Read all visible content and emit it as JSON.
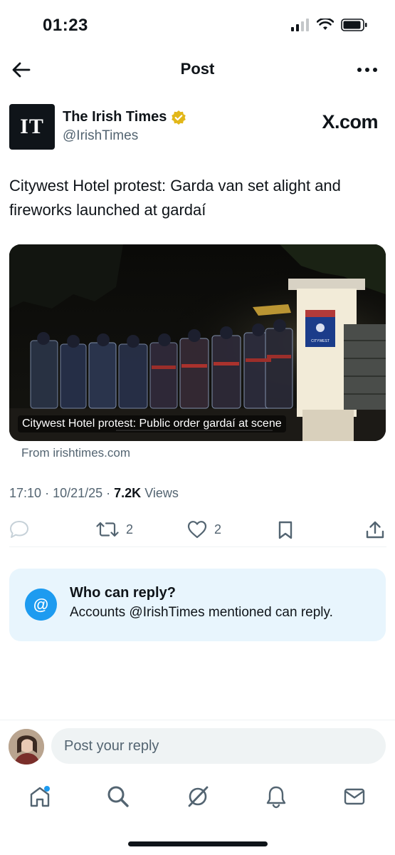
{
  "status": {
    "time": "01:23"
  },
  "header": {
    "title": "Post"
  },
  "author": {
    "avatar_text": "IT",
    "name": "The Irish Times",
    "handle": "@IrishTimes",
    "source_brand": "X.com",
    "verified": true
  },
  "tweet": {
    "text": "Citywest Hotel protest: Garda van set alight and fireworks launched at gardaí"
  },
  "media": {
    "caption": "Citywest Hotel protest: Public order gardaí at scene",
    "sign_text": "CITYWEST",
    "from": "From irishtimes.com"
  },
  "meta": {
    "time": "17:10",
    "date": "10/21/25",
    "views_count": "7.2K",
    "views_label": "Views"
  },
  "actions": {
    "reposts": "2",
    "likes": "2"
  },
  "who_can_reply": {
    "icon": "@",
    "title": "Who can reply?",
    "subtitle": "Accounts @IrishTimes mentioned can reply."
  },
  "composer": {
    "placeholder": "Post your reply"
  },
  "colors": {
    "accent": "#1d9bf0",
    "muted": "#536471",
    "verified": "#e2b719",
    "reply_bg": "#e8f5fd"
  },
  "icons": [
    "back-arrow-icon",
    "more-icon",
    "verified-badge-icon",
    "reply-icon",
    "repost-icon",
    "like-icon",
    "bookmark-icon",
    "share-icon",
    "home-icon",
    "search-icon",
    "grok-icon",
    "notifications-icon",
    "messages-icon"
  ]
}
